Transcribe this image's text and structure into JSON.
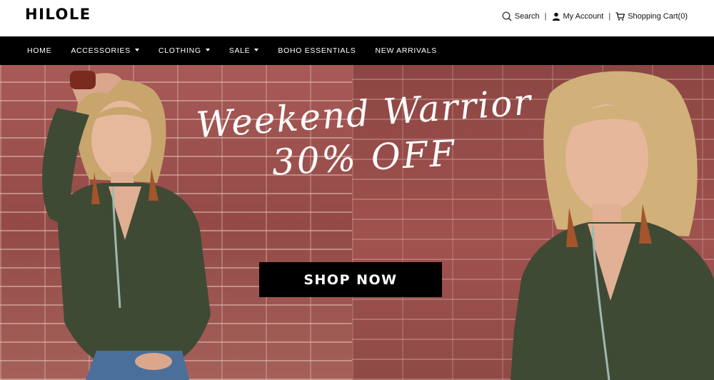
{
  "header": {
    "logo": "HILOLE",
    "search_label": "Search",
    "account_label": "My Account",
    "cart_label": "Shopping Cart(0)",
    "separator": "|"
  },
  "nav": {
    "items": [
      {
        "label": "HOME",
        "dropdown": false
      },
      {
        "label": "ACCESSORIES",
        "dropdown": true
      },
      {
        "label": "CLOTHING",
        "dropdown": true
      },
      {
        "label": "SALE",
        "dropdown": true
      },
      {
        "label": "BOHO ESSENTIALS",
        "dropdown": false
      },
      {
        "label": "NEW ARRIVALS",
        "dropdown": false
      }
    ]
  },
  "hero": {
    "headline_line1": "Weekend Warrior",
    "headline_line2": "30% OFF",
    "cta_label": "SHOP NOW"
  },
  "colors": {
    "nav_bg": "#000000",
    "brick": "#9a4f4c",
    "shirt": "#3f4a34"
  }
}
